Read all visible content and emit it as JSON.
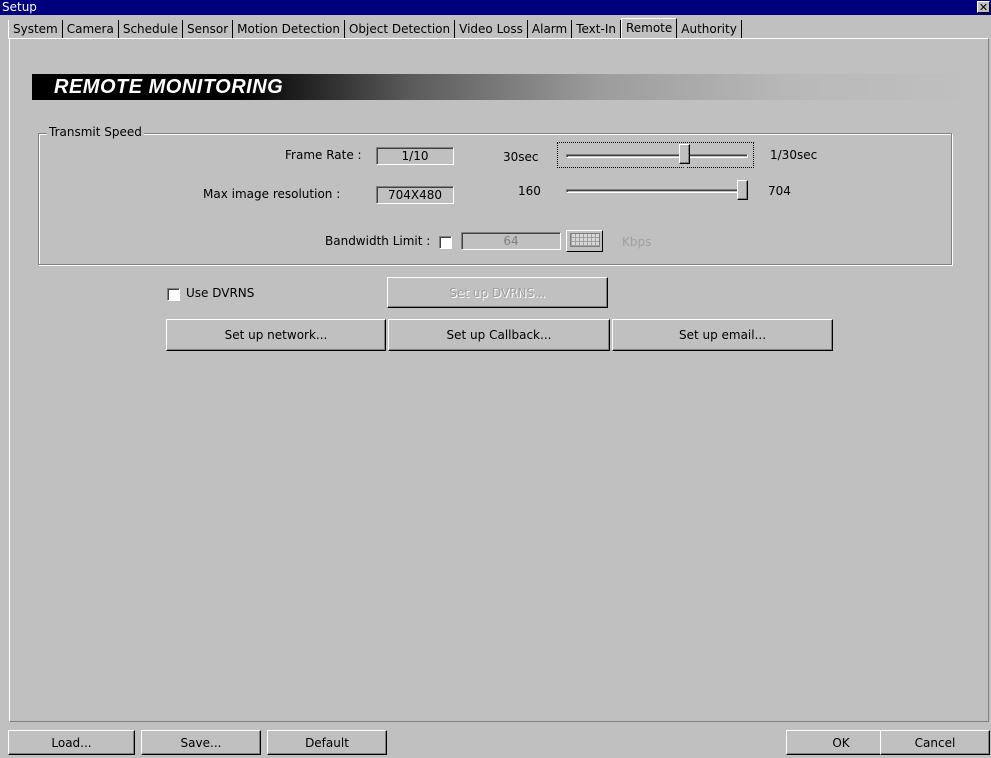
{
  "window": {
    "title": "Setup",
    "close_symbol": "✕"
  },
  "tabs": [
    {
      "label": "System"
    },
    {
      "label": "Camera"
    },
    {
      "label": "Schedule"
    },
    {
      "label": "Sensor"
    },
    {
      "label": "Motion Detection"
    },
    {
      "label": "Object Detection"
    },
    {
      "label": "Video Loss"
    },
    {
      "label": "Alarm"
    },
    {
      "label": "Text-In"
    },
    {
      "label": "Remote",
      "active": true
    },
    {
      "label": "Authority"
    }
  ],
  "banner": {
    "title": "REMOTE MONITORING"
  },
  "transmit_speed": {
    "legend": "Transmit Speed",
    "frame_rate": {
      "label": "Frame Rate :",
      "value": "1/10",
      "min_label": "30sec",
      "max_label": "1/30sec",
      "slider_fraction": 0.66
    },
    "resolution": {
      "label": "Max image resolution :",
      "value": "704X480",
      "min_label": "160",
      "max_label": "704",
      "slider_fraction": 1.0
    },
    "bandwidth": {
      "label": "Bandwidth Limit :",
      "checked": false,
      "value": "64",
      "unit": "Kbps",
      "keyboard_icon": "keyboard-icon"
    }
  },
  "dvrns": {
    "checkbox_label": "Use DVRNS",
    "checked": false,
    "setup_button": "Set up DVRNS..."
  },
  "setup_buttons": {
    "network": "Set up network...",
    "callback": "Set up Callback...",
    "email": "Set up email..."
  },
  "footer": {
    "load": "Load...",
    "save": "Save...",
    "default": "Default",
    "ok": "OK",
    "cancel": "Cancel"
  }
}
